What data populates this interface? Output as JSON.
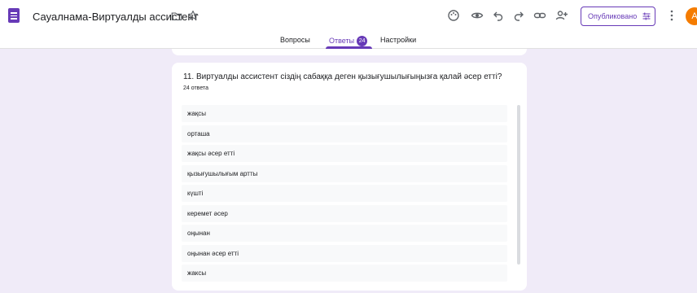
{
  "header": {
    "title": "Сауалнама-Виртуалды ассистент",
    "publish_label": "Опубликовано",
    "avatar_letter": "A"
  },
  "tabs": [
    {
      "label": "Вопросы"
    },
    {
      "label": "Ответы",
      "badge": "24"
    },
    {
      "label": "Настройки"
    }
  ],
  "question": {
    "text": "11. Виртуалды ассистент сіздің сабаққа деген қызығушылығыңызға қалай әсер етті?",
    "response_count": "24 ответа",
    "answers": [
      "жақсы",
      "орташа",
      "жақсы әсер етті",
      "қызығушылығым артты",
      "күшті",
      "керемет әсер",
      "оңынан",
      "оңынан әсер етті",
      "жаксы"
    ]
  },
  "colors": {
    "accent": "#673ab7",
    "avatar": "#f57c00",
    "background": "#f0ebf8"
  }
}
